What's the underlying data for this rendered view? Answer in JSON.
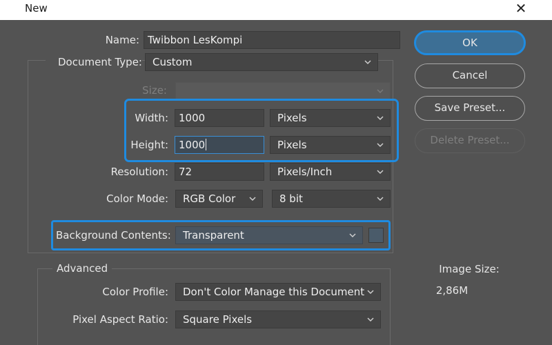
{
  "window": {
    "title": "New",
    "close_glyph": "✕"
  },
  "form": {
    "name": {
      "label": "Name:",
      "value": "Twibbon LesKompi"
    },
    "document_type": {
      "label": "Document Type:",
      "value": "Custom"
    },
    "size": {
      "label": "Size:",
      "value": ""
    },
    "width": {
      "label": "Width:",
      "value": "1000",
      "unit": "Pixels"
    },
    "height": {
      "label": "Height:",
      "value": "1000",
      "unit": "Pixels"
    },
    "resolution": {
      "label": "Resolution:",
      "value": "72",
      "unit": "Pixels/Inch"
    },
    "color_mode": {
      "label": "Color Mode:",
      "value": "RGB Color",
      "depth": "8 bit"
    },
    "background_contents": {
      "label": "Background Contents:",
      "value": "Transparent"
    }
  },
  "advanced": {
    "legend": "Advanced",
    "color_profile": {
      "label": "Color Profile:",
      "value": "Don't Color Manage this Document"
    },
    "pixel_aspect_ratio": {
      "label": "Pixel Aspect Ratio:",
      "value": "Square Pixels"
    }
  },
  "buttons": {
    "ok": "OK",
    "cancel": "Cancel",
    "save_preset": "Save Preset...",
    "delete_preset": "Delete Preset..."
  },
  "image_size": {
    "label": "Image Size:",
    "value": "2,86M"
  },
  "colors": {
    "highlight": "#1f8be0",
    "background": "#535353",
    "field": "#454545"
  }
}
